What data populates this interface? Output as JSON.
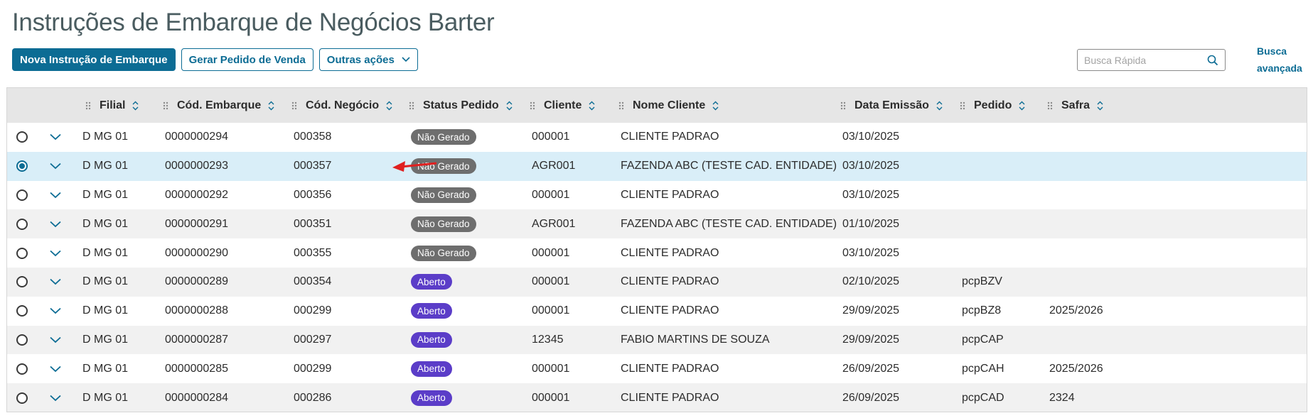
{
  "page": {
    "title": "Instruções de Embarque de Negócios Barter"
  },
  "toolbar": {
    "new_label": "Nova Instrução de Embarque",
    "generate_label": "Gerar Pedido de Venda",
    "more_label": "Outras ações"
  },
  "search": {
    "placeholder": "Busca Rápida",
    "advanced_line1": "Busca",
    "advanced_line2": "avançada"
  },
  "table": {
    "columns": [
      "Filial",
      "Cód. Embarque",
      "Cód. Negócio",
      "Status Pedido",
      "Cliente",
      "Nome Cliente",
      "Data Emissão",
      "Pedido",
      "Safra"
    ],
    "status_colors": {
      "Não Gerado": "#6e6e6e",
      "Aberto": "#5b3dc8"
    },
    "selected_row_color": "#d9eef8",
    "rows": [
      {
        "filial": "D MG 01",
        "cod_embarque": "0000000294",
        "cod_negocio": "000358",
        "status": "Não Gerado",
        "cliente": "000001",
        "nome_cliente": "CLIENTE PADRAO",
        "data_emissao": "03/10/2025",
        "pedido": "",
        "safra": "",
        "selected": false
      },
      {
        "filial": "D MG 01",
        "cod_embarque": "0000000293",
        "cod_negocio": "000357",
        "status": "Não Gerado",
        "cliente": "AGR001",
        "nome_cliente": "FAZENDA ABC (TESTE CAD. ENTIDADE)",
        "data_emissao": "03/10/2025",
        "pedido": "",
        "safra": "",
        "selected": true
      },
      {
        "filial": "D MG 01",
        "cod_embarque": "0000000292",
        "cod_negocio": "000356",
        "status": "Não Gerado",
        "cliente": "000001",
        "nome_cliente": "CLIENTE PADRAO",
        "data_emissao": "03/10/2025",
        "pedido": "",
        "safra": "",
        "selected": false
      },
      {
        "filial": "D MG 01",
        "cod_embarque": "0000000291",
        "cod_negocio": "000351",
        "status": "Não Gerado",
        "cliente": "AGR001",
        "nome_cliente": "FAZENDA ABC (TESTE CAD. ENTIDADE)",
        "data_emissao": "01/10/2025",
        "pedido": "",
        "safra": "",
        "selected": false
      },
      {
        "filial": "D MG 01",
        "cod_embarque": "0000000290",
        "cod_negocio": "000355",
        "status": "Não Gerado",
        "cliente": "000001",
        "nome_cliente": "CLIENTE PADRAO",
        "data_emissao": "03/10/2025",
        "pedido": "",
        "safra": "",
        "selected": false
      },
      {
        "filial": "D MG 01",
        "cod_embarque": "0000000289",
        "cod_negocio": "000354",
        "status": "Aberto",
        "cliente": "000001",
        "nome_cliente": "CLIENTE PADRAO",
        "data_emissao": "02/10/2025",
        "pedido": "pcpBZV",
        "safra": "",
        "selected": false
      },
      {
        "filial": "D MG 01",
        "cod_embarque": "0000000288",
        "cod_negocio": "000299",
        "status": "Aberto",
        "cliente": "000001",
        "nome_cliente": "CLIENTE PADRAO",
        "data_emissao": "29/09/2025",
        "pedido": "pcpBZ8",
        "safra": "2025/2026",
        "selected": false
      },
      {
        "filial": "D MG 01",
        "cod_embarque": "0000000287",
        "cod_negocio": "000297",
        "status": "Aberto",
        "cliente": "12345",
        "nome_cliente": "FABIO MARTINS DE SOUZA",
        "data_emissao": "29/09/2025",
        "pedido": "pcpCAP",
        "safra": "",
        "selected": false
      },
      {
        "filial": "D MG 01",
        "cod_embarque": "0000000285",
        "cod_negocio": "000299",
        "status": "Aberto",
        "cliente": "000001",
        "nome_cliente": "CLIENTE PADRAO",
        "data_emissao": "26/09/2025",
        "pedido": "pcpCAH",
        "safra": "2025/2026",
        "selected": false
      },
      {
        "filial": "D MG 01",
        "cod_embarque": "0000000284",
        "cod_negocio": "000286",
        "status": "Aberto",
        "cliente": "000001",
        "nome_cliente": "CLIENTE PADRAO",
        "data_emissao": "26/09/2025",
        "pedido": "pcpCAD",
        "safra": "2324",
        "selected": false
      }
    ]
  },
  "annotation": {
    "icon": "red-arrow-icon",
    "color": "#e02020"
  }
}
